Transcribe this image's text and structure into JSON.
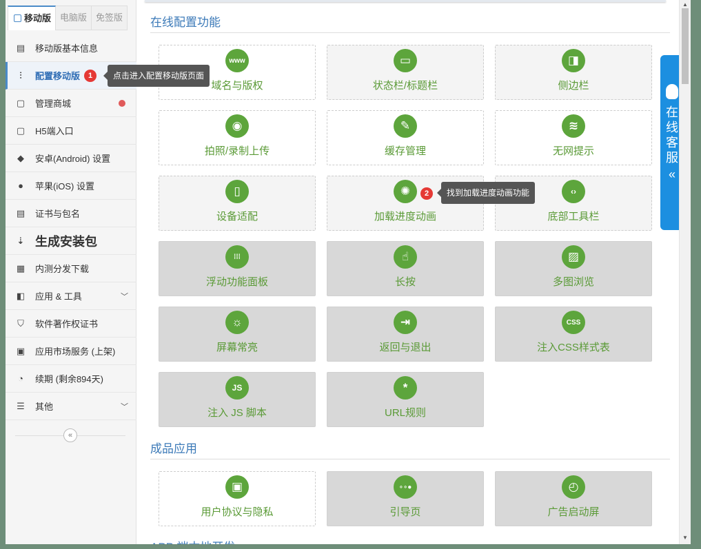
{
  "tabs": [
    "移动版",
    "电脑版",
    "免签版"
  ],
  "menu": [
    {
      "label": "移动版基本信息",
      "icon": "document-icon"
    },
    {
      "label": "配置移动版",
      "icon": "sliders-icon",
      "active": true,
      "badge": "1"
    },
    {
      "label": "管理商城",
      "icon": "bag-icon",
      "dot": true
    },
    {
      "label": "H5端入口",
      "icon": "bag-icon"
    },
    {
      "label": "安卓(Android) 设置",
      "icon": "android-icon"
    },
    {
      "label": "苹果(iOS) 设置",
      "icon": "apple-icon"
    },
    {
      "label": "证书与包名",
      "icon": "certificate-icon"
    },
    {
      "label": "生成安装包",
      "icon": "sort-icon",
      "big": true
    },
    {
      "label": "内测分发下载",
      "icon": "qr-icon"
    },
    {
      "label": "应用 & 工具",
      "icon": "apps-icon",
      "chevron": true
    },
    {
      "label": "软件著作权证书",
      "icon": "shield-icon"
    },
    {
      "label": "应用市场服务 (上架)",
      "icon": "store-icon"
    },
    {
      "label": "续期 (剩余894天)",
      "icon": "clock-icon"
    },
    {
      "label": "其他",
      "icon": "menu-icon",
      "chevron": true
    }
  ],
  "tooltip1": "点击进入配置移动版页面",
  "tooltip2": "找到加载进度动画功能",
  "badge2": "2",
  "section1": "在线配置功能",
  "section2": "成品应用",
  "section3": "APP 端本地开发",
  "features": [
    {
      "label": "域名与版权",
      "icon": "www-icon",
      "style": "white"
    },
    {
      "label": "状态栏/标题栏",
      "icon": "window-icon",
      "style": "light"
    },
    {
      "label": "侧边栏",
      "icon": "sidebar-icon",
      "style": "light"
    },
    {
      "label": "拍照/录制上传",
      "icon": "camera-icon",
      "style": "white"
    },
    {
      "label": "缓存管理",
      "icon": "broom-icon",
      "style": "white"
    },
    {
      "label": "无网提示",
      "icon": "no-wifi-icon",
      "style": "white"
    },
    {
      "label": "设备适配",
      "icon": "devices-icon",
      "style": "light"
    },
    {
      "label": "加载进度动画",
      "icon": "spinner-icon",
      "style": "light"
    },
    {
      "label": "底部工具栏",
      "icon": "code-icon",
      "style": "light"
    },
    {
      "label": "浮动功能面板",
      "icon": "grid-dots-icon",
      "style": "gray"
    },
    {
      "label": "长按",
      "icon": "hand-icon",
      "style": "gray"
    },
    {
      "label": "多图浏览",
      "icon": "image-icon",
      "style": "gray"
    },
    {
      "label": "屏幕常亮",
      "icon": "sun-icon",
      "style": "gray"
    },
    {
      "label": "返回与退出",
      "icon": "exit-icon",
      "style": "gray"
    },
    {
      "label": "注入CSS样式表",
      "icon": "css-icon",
      "style": "gray"
    },
    {
      "label": "注入 JS 脚本",
      "icon": "js-icon",
      "style": "gray"
    },
    {
      "label": "URL规则",
      "icon": "asterisk-icon",
      "style": "gray"
    }
  ],
  "apps": [
    {
      "label": "用户协议与隐私",
      "icon": "user-doc-icon",
      "style": "white"
    },
    {
      "label": "引导页",
      "icon": "dots-icon",
      "style": "gray"
    },
    {
      "label": "广告启动屏",
      "icon": "timer-icon",
      "style": "gray"
    }
  ],
  "kefu": "在线客服",
  "colors": {
    "accent": "#5da53c",
    "blue": "#1c8fe0",
    "badge": "#e53935"
  }
}
